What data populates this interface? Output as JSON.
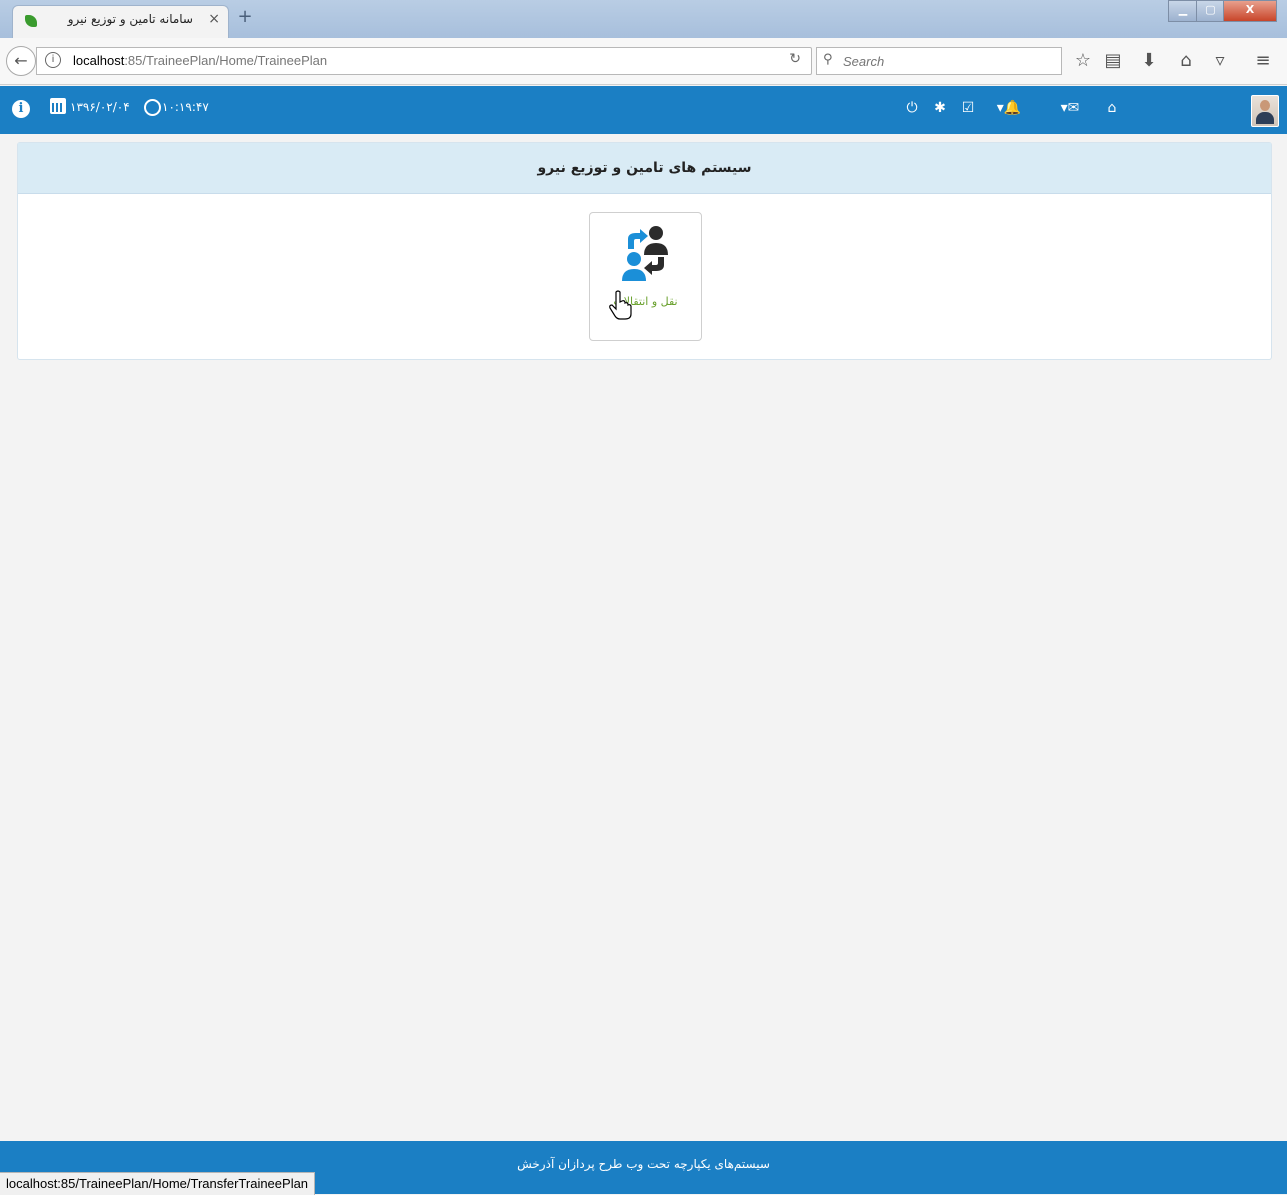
{
  "browser": {
    "tab_title": "سامانه تامین و توزیع نیرو",
    "tab_close": "×",
    "new_tab": "+",
    "url_host": "localhost",
    "url_path": ":85/TraineePlan/Home/TraineePlan",
    "search_placeholder": "Search",
    "status_url": "localhost:85/TraineePlan/Home/TransferTraineePlan"
  },
  "header": {
    "date": "۱۳۹۶/۰۲/۰۴",
    "time": "۱۰:۱۹:۴۷"
  },
  "panel": {
    "title": "سیستم های تامین و توزیع نیرو",
    "tiles": [
      {
        "label": "نقل و انتقالات"
      }
    ]
  },
  "footer": {
    "text": "سیستم‌های یکپارچه تحت وب طرح پردازان آذرخش"
  },
  "colors": {
    "primary": "#1b7fc4",
    "panel_heading": "#d9ebf5",
    "tile_label": "#6aa12e"
  }
}
